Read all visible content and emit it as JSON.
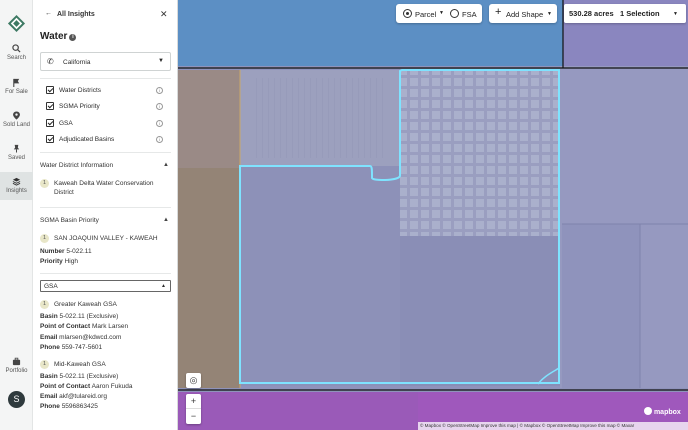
{
  "rail": {
    "items": [
      {
        "label": "Search",
        "icon": "search-icon"
      },
      {
        "label": "For Sale",
        "icon": "flag-icon"
      },
      {
        "label": "Sold Land",
        "icon": "pin-icon"
      },
      {
        "label": "Saved",
        "icon": "pushpin-icon"
      },
      {
        "label": "Insights",
        "icon": "layers-icon"
      },
      {
        "label": "Portfolio",
        "icon": "briefcase-icon"
      }
    ],
    "avatar_initial": "S"
  },
  "panel": {
    "back_label": "All Insights",
    "title": "Water",
    "state_value": "California",
    "layers": [
      {
        "label": "Water Districts",
        "checked": true
      },
      {
        "label": "SGMA Priority",
        "checked": true
      },
      {
        "label": "GSA",
        "checked": true
      },
      {
        "label": "Adjudicated Basins",
        "checked": true
      }
    ],
    "water_district": {
      "title": "Water District Information",
      "index": "1",
      "name_line1": "Kaweah Delta Water Conservation",
      "name_line2": "District"
    },
    "sgma": {
      "title": "SGMA Basin Priority",
      "index": "1",
      "name": "SAN JOAQUIN VALLEY - KAWEAH",
      "number_label": "Number",
      "number_value": "5-022.11",
      "priority_label": "Priority",
      "priority_value": "High"
    },
    "gsa_select_value": "GSA",
    "gsa_items": [
      {
        "index": "1",
        "name": "Greater Kaweah GSA",
        "basin_label": "Basin",
        "basin_value": "5-022.11 (Exclusive)",
        "contact_label": "Point of Contact",
        "contact_value": "Mark Larsen",
        "email_label": "Email",
        "email_value": "mlarsen@kdwcd.com",
        "phone_label": "Phone",
        "phone_value": "559-747-5601"
      },
      {
        "index": "1",
        "name": "Mid-Kaweah GSA",
        "basin_label": "Basin",
        "basin_value": "5-022.11 (Exclusive)",
        "contact_label": "Point of Contact",
        "contact_value": "Aaron Fukuda",
        "email_label": "Email",
        "email_value": "akf@tulareid.org",
        "phone_label": "Phone",
        "phone_value": "5596863425"
      }
    ]
  },
  "map": {
    "parcel_label": "Parcel",
    "fsa_label": "FSA",
    "add_shape_label": "Add Shape",
    "acres": "530.28 acres",
    "selection": "1 Selection",
    "mapbox_logo": "mapbox",
    "attribution": "© Mapbox © OpenStreetMap Improve this map | © Mapbox © OpenStreetMap Improve this map © Maxar",
    "colors": {
      "blue_overlay": "#5aa6d6",
      "purple_overlay": "#8b84c9",
      "magenta_overlay": "#9a4fb5",
      "selection_outline": "#7fe3ff"
    }
  }
}
